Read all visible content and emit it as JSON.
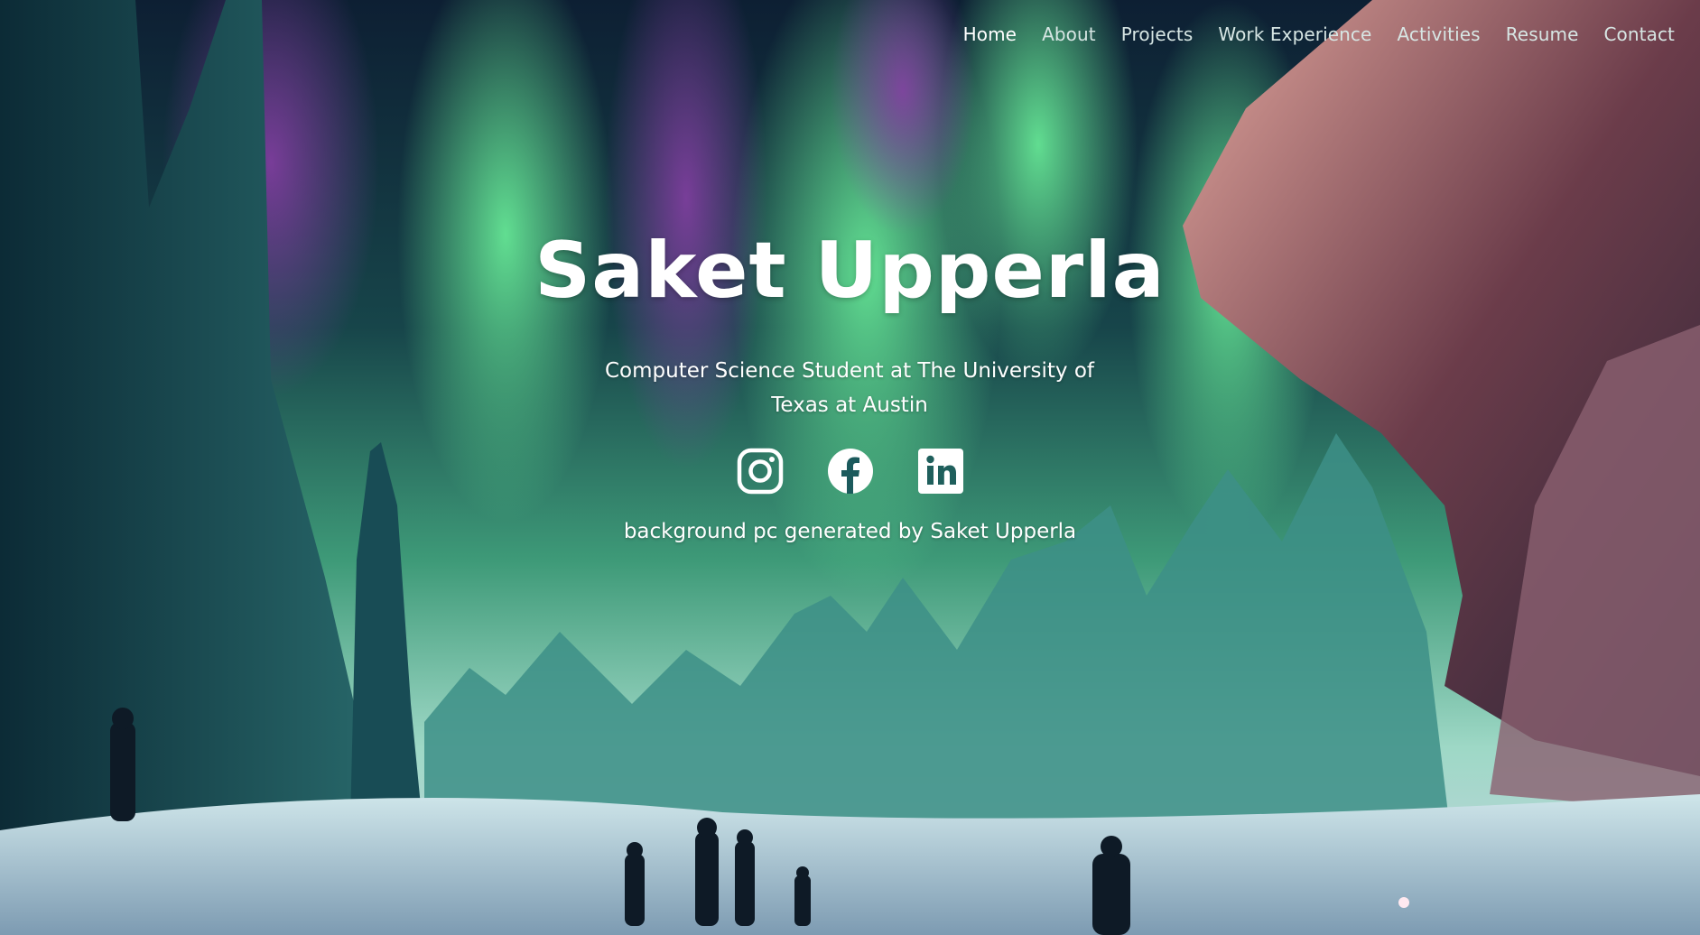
{
  "nav": {
    "items": [
      {
        "label": "Home",
        "active": true
      },
      {
        "label": "About",
        "active": false
      },
      {
        "label": "Projects",
        "active": false
      },
      {
        "label": "Work Experience",
        "active": false
      },
      {
        "label": "Activities",
        "active": false
      },
      {
        "label": "Resume",
        "active": false
      },
      {
        "label": "Contact",
        "active": false
      }
    ]
  },
  "hero": {
    "title": "Saket Upperla",
    "subtitle": "Computer Science Student at The University of Texas at Austin",
    "credit": "background pc generated by Saket Upperla"
  },
  "socials": [
    {
      "icon": "instagram-icon"
    },
    {
      "icon": "facebook-icon"
    },
    {
      "icon": "linkedin-icon"
    }
  ],
  "colors": {
    "text": "#ffffff",
    "nav_text": "#d7e6e4",
    "aurora_green": "#5ee08a",
    "aurora_purple": "#8a3fa8",
    "sky_dark": "#0f2a3c"
  }
}
